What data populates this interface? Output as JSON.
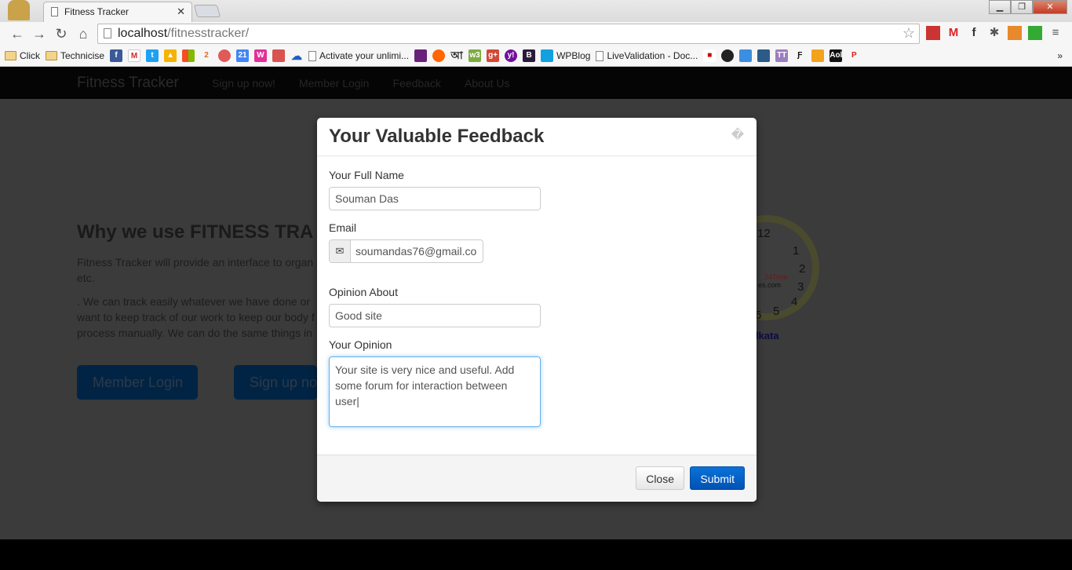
{
  "browser": {
    "tab_title": "Fitness Tracker",
    "url_host": "localhost",
    "url_path": "/fitnesstracker/",
    "bookmarks": [
      "Click",
      "Technicise",
      "Activate your unlimi...",
      "WPBlog",
      "LiveValidation - Doc..."
    ],
    "overflow": "»"
  },
  "navbar": {
    "brand": "Fitness Tracker",
    "links": [
      "Sign up now!",
      "Member Login",
      "Feedback",
      "About Us"
    ]
  },
  "hero": {
    "heading": "Why we use FITNESS TRA",
    "p1_line1": "Fitness Tracker will provide an interface to organ",
    "p1_line2": "etc.",
    "p2_line1": ". We can track easily whatever we have done or",
    "p2_line2": "want to keep track of our work to keep our body f",
    "p2_line3": "process manually. We can do the same things in",
    "btn_login": "Member Login",
    "btn_signup": "Sign up no"
  },
  "clock": {
    "numbers": [
      "12",
      "1",
      "2",
      "3",
      "4",
      "5",
      "6"
    ],
    "brand": "24Time",
    "brand2": "es.com",
    "city": "olkata"
  },
  "modal": {
    "title": "Your Valuable Feedback",
    "close_glyph": "�",
    "name_label": "Your Full Name",
    "name_value": "Souman Das",
    "email_label": "Email",
    "email_value": "soumandas76@gmail.co",
    "about_label": "Opinion About",
    "about_value": "Good site",
    "opinion_label": "Your Opinion",
    "opinion_line1": "Your site is very nice and useful. Add",
    "opinion_line2": "some forum for interaction between user",
    "close_btn": "Close",
    "submit_btn": "Submit"
  }
}
